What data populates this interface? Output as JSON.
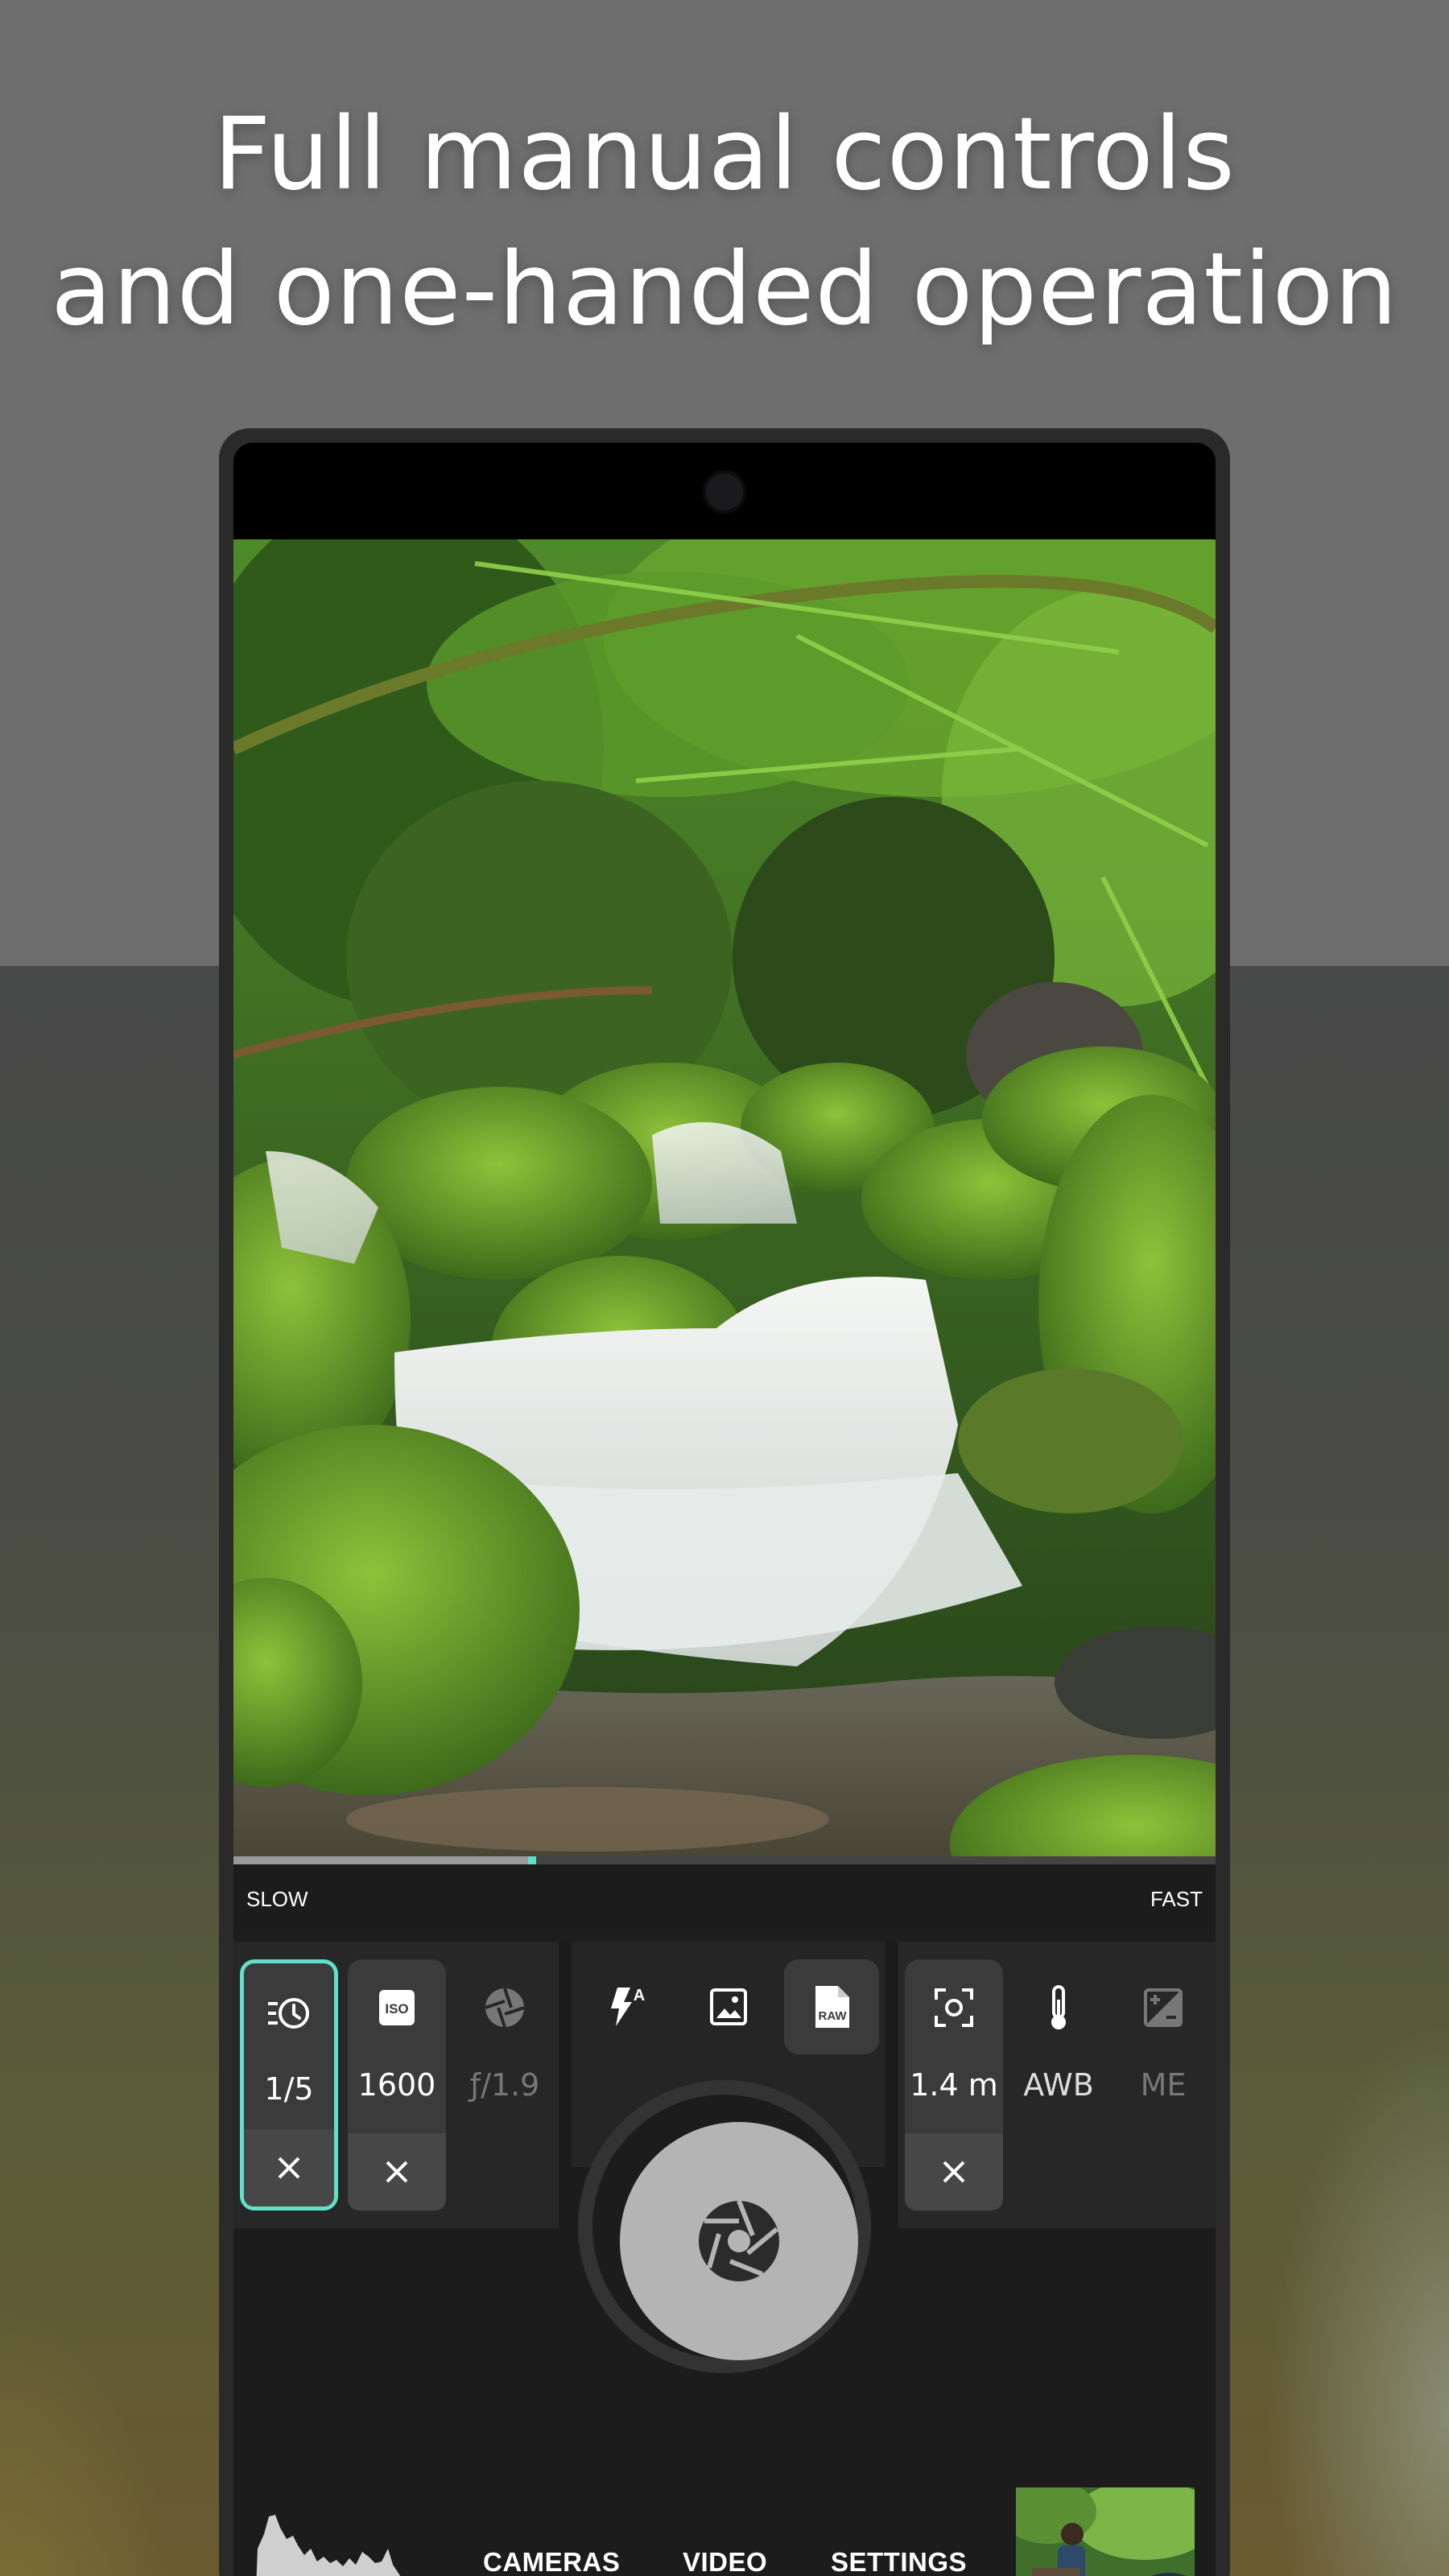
{
  "headline": {
    "line1": "Full manual controls",
    "line2": "and one-handed operation"
  },
  "speed_slider": {
    "slow_label": "SLOW",
    "fast_label": "FAST",
    "position_fraction": 0.3
  },
  "manual_controls": {
    "shutter_speed": {
      "icon": "shutter-speed-icon",
      "value": "1/5",
      "state": "selected"
    },
    "iso": {
      "icon": "iso-icon",
      "value": "1600",
      "state": "manual"
    },
    "aperture": {
      "icon": "aperture-icon",
      "value": "ƒ/1.9",
      "state": "disabled"
    },
    "focus": {
      "icon": "focus-icon",
      "value": "1.4 m",
      "state": "manual"
    },
    "white_balance": {
      "icon": "thermometer-icon",
      "value": "AWB",
      "state": "auto"
    },
    "exposure": {
      "icon": "exposure-icon",
      "value": "ME",
      "state": "disabled"
    }
  },
  "mode_icons": [
    {
      "name": "flash-auto-icon",
      "active": false
    },
    {
      "name": "image-format-icon",
      "active": false
    },
    {
      "name": "raw-icon",
      "label": "RAW",
      "active": true
    }
  ],
  "bottom_nav": {
    "cameras": "CAMERAS",
    "video": "VIDEO",
    "settings": "SETTINGS"
  },
  "colors": {
    "accent": "#5fe0c8",
    "panel": "#272727",
    "background": "#1c1c1c"
  }
}
